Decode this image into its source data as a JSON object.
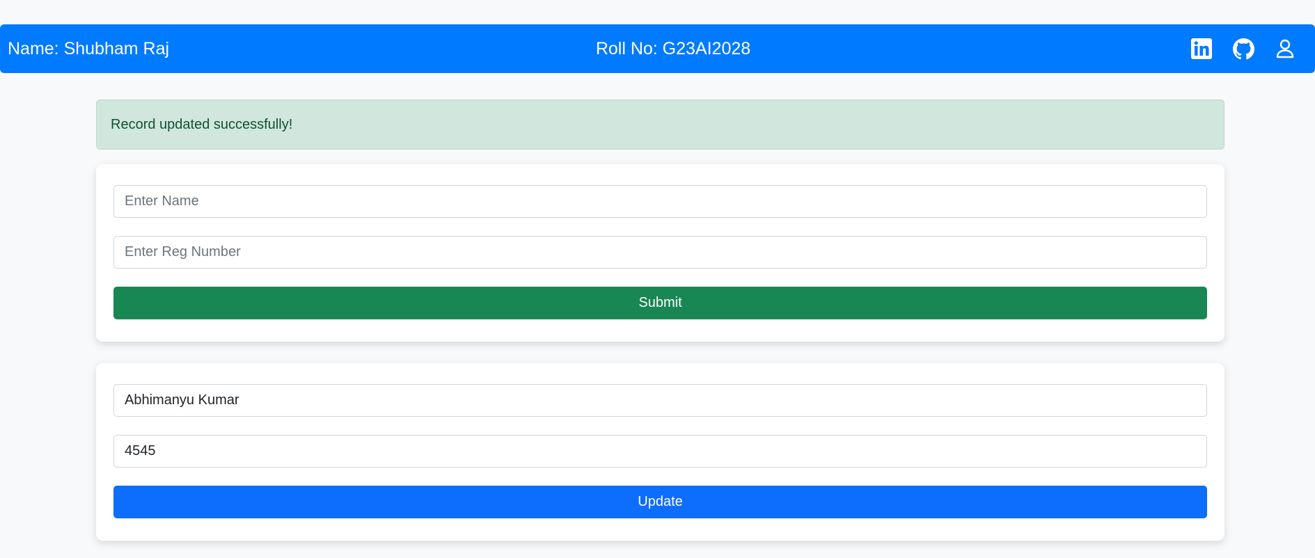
{
  "navbar": {
    "name_text": "Name: Shubham Raj",
    "roll_text": "Roll No: G23AI2028",
    "background": "#007bff",
    "icons": [
      "linkedin-icon",
      "github-icon",
      "user-icon"
    ]
  },
  "alert": {
    "message": "Record updated successfully!",
    "background": "#d1e7dd",
    "text_color": "#0f5132"
  },
  "add_form": {
    "name_placeholder": "Enter Name",
    "name_value": "",
    "reg_placeholder": "Enter Reg Number",
    "reg_value": "",
    "submit_label": "Submit",
    "submit_color": "#198754"
  },
  "edit_form": {
    "name_value": "Abhimanyu Kumar",
    "reg_value": "4545",
    "update_label": "Update",
    "update_color": "#0d6efd"
  }
}
